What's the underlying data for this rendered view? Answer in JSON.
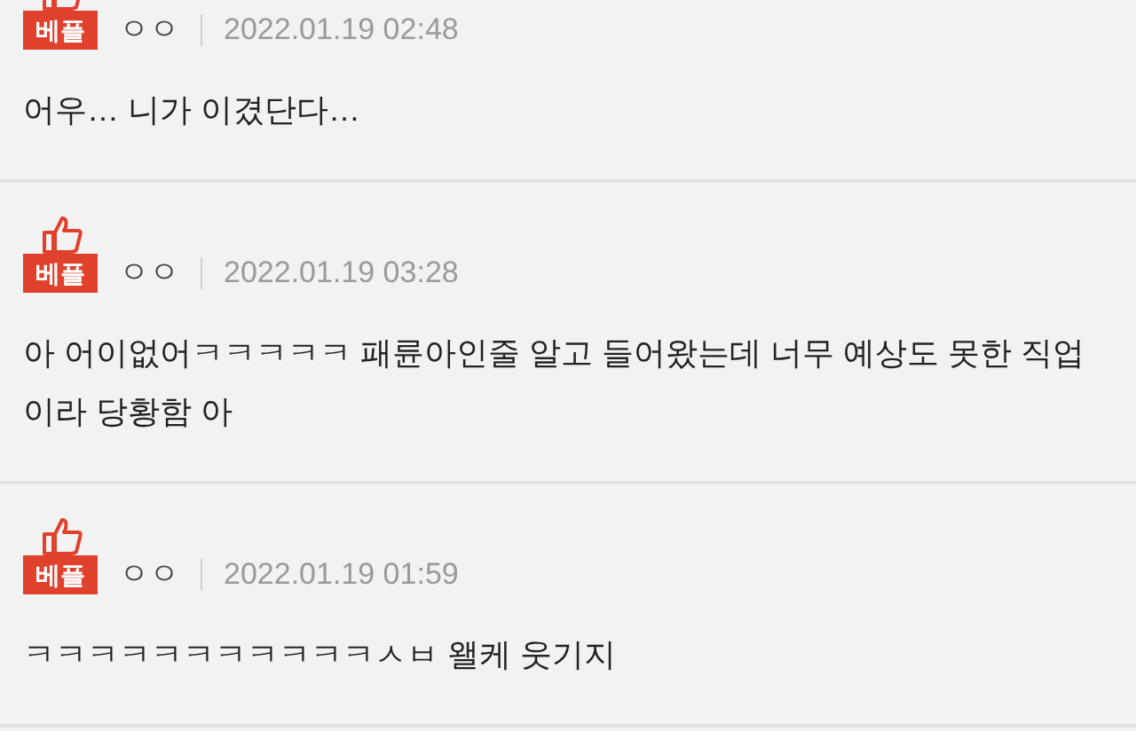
{
  "comments": [
    {
      "badge": "베플",
      "author": "ㅇㅇ",
      "date": "2022.01.19 02:48",
      "text": "어우… 니가 이겼단다…"
    },
    {
      "badge": "베플",
      "author": "ㅇㅇ",
      "date": "2022.01.19 03:28",
      "text": "아 어이없어ㅋㅋㅋㅋㅋ 패륜아인줄 알고 들어왔는데 너무 예상도 못한 직업이라 당황함 아"
    },
    {
      "badge": "베플",
      "author": "ㅇㅇ",
      "date": "2022.01.19 01:59",
      "text": "ㅋㅋㅋㅋㅋㅋㅋㅋㅋㅋㅋㅅㅂ 왤케 웃기지"
    }
  ]
}
